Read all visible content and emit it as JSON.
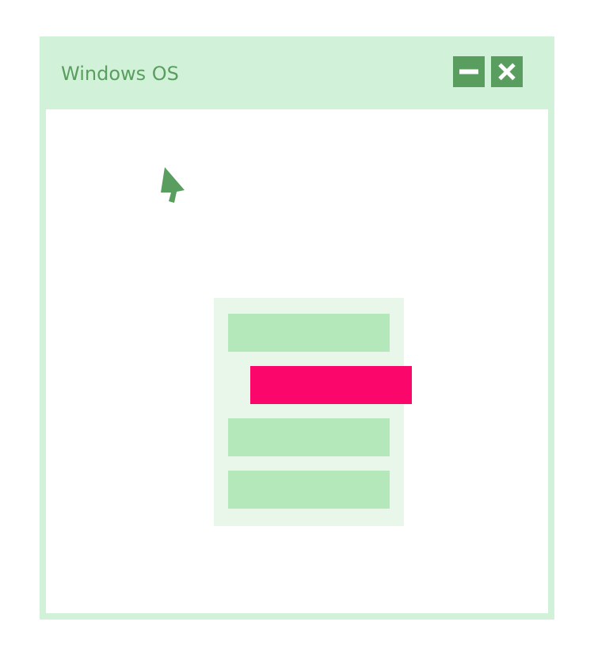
{
  "window": {
    "title": "Windows OS"
  },
  "controls": [
    {
      "name": "minimize-button",
      "icon": "minimize-icon"
    },
    {
      "name": "close-button",
      "icon": "close-icon"
    }
  ],
  "menu": {
    "items": [
      {
        "state": "normal"
      },
      {
        "state": "dragging",
        "color": "#fb066b"
      },
      {
        "state": "normal"
      },
      {
        "state": "normal"
      }
    ]
  },
  "cursor": {
    "icon": "pointer-arrow-icon"
  },
  "colors": {
    "window_frame": "#d1f2d8",
    "accent": "#5a9e5f",
    "menu_bg": "#e8f7ea",
    "menu_item": "#b4e7b9",
    "drag_highlight": "#fb066b"
  }
}
